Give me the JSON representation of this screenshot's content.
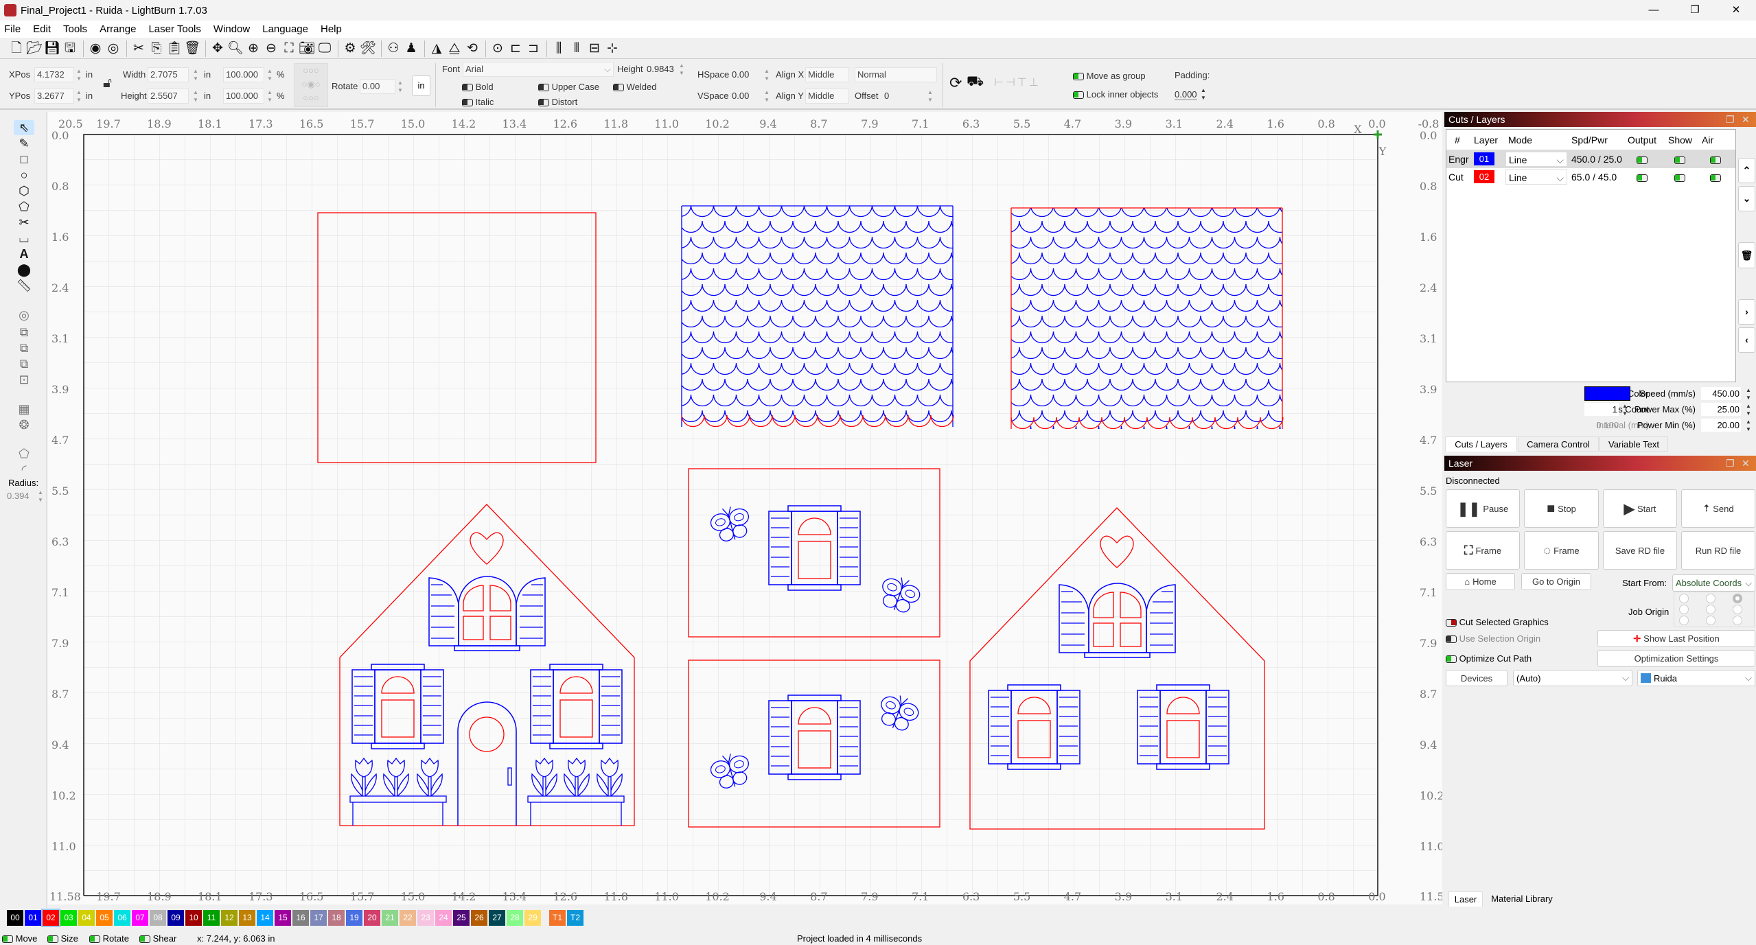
{
  "window": {
    "title": "Final_Project1 - Ruida - LightBurn 1.7.03",
    "minimize": "—",
    "maximize": "❐",
    "close": "✕"
  },
  "menu": [
    "File",
    "Edit",
    "Tools",
    "Arrange",
    "Laser Tools",
    "Window",
    "Language",
    "Help"
  ],
  "toolbar_icons": [
    "new-file",
    "open-file",
    "save",
    "save-as",
    "import",
    "export",
    "cut",
    "copy",
    "paste",
    "delete",
    "move",
    "zoom-to-page",
    "zoom-in",
    "zoom-out",
    "zoom-to-frame",
    "camera",
    "monitor",
    "settings",
    "machine-settings",
    "group",
    "ungroup",
    "mirror-horizontal",
    "mirror-vertical",
    "rotate",
    "align-center",
    "align-left",
    "align-right",
    "distribute-h",
    "distribute-v",
    "arrange-row",
    "snap"
  ],
  "props": {
    "xpos_label": "XPos",
    "xpos": "4.1732",
    "ypos_label": "YPos",
    "ypos": "3.2677",
    "unit": "in",
    "width_label": "Width",
    "width": "2.7075",
    "height_label": "Height",
    "height": "2.5507",
    "scale_x": "100.000",
    "scale_y": "100.000",
    "percent": "%",
    "rotate_label": "Rotate",
    "rotate": "0.00",
    "units_button": "in",
    "font_label": "Font",
    "font": "Arial",
    "font_height_label": "Height",
    "font_height": "0.9843",
    "bold": "Bold",
    "italic": "Italic",
    "upper_case": "Upper Case",
    "distort": "Distort",
    "welded": "Welded",
    "hspace_label": "HSpace",
    "hspace": "0.00",
    "vspace_label": "VSpace",
    "vspace": "0.00",
    "align_x_label": "Align X",
    "align_x": "Middle",
    "align_y_label": "Align Y",
    "align_y": "Middle",
    "text_mode": "Normal",
    "offset_label": "Offset",
    "offset": "0",
    "move_as_group": "Move as group",
    "lock_inner": "Lock inner objects",
    "padding_label": "Padding:",
    "padding": "0.000"
  },
  "left_tools": {
    "radius_label": "Radius:",
    "radius": "0.394"
  },
  "rulers": {
    "top": [
      "20.5",
      "19.7",
      "18.9",
      "18.1",
      "17.3",
      "16.5",
      "15.7",
      "15.0",
      "14.2",
      "13.4",
      "12.6",
      "11.8",
      "11.0",
      "10.2",
      "9.4",
      "8.7",
      "7.9",
      "7.1",
      "6.3",
      "5.5",
      "4.7",
      "3.9",
      "3.1",
      "2.4",
      "1.6",
      "0.8",
      "0.0"
    ],
    "top_extra": "-0.8",
    "side": [
      "0.0",
      "0.8",
      "1.6",
      "2.4",
      "3.1",
      "3.9",
      "4.7",
      "5.5",
      "6.3",
      "7.1",
      "7.9",
      "8.7",
      "9.4",
      "10.2",
      "11.0"
    ],
    "side_end": "11.58",
    "corner_x": "X",
    "corner_y": "Y"
  },
  "colors": {
    "engrave": "#0000ff",
    "cut": "#ff0000",
    "accent_on": "#1fbf1f"
  },
  "cuts_layers": {
    "title": "Cuts / Layers",
    "columns": [
      "#",
      "Layer",
      "Mode",
      "Spd/Pwr",
      "Output",
      "Show",
      "Air"
    ],
    "rows": [
      {
        "name": "Engr",
        "layer": "01",
        "color": "#0000ff",
        "mode": "Line",
        "spdpwr": "450.0 / 25.0",
        "output": true,
        "show": true,
        "air": true
      },
      {
        "name": "Cut",
        "layer": "02",
        "color": "#ff0000",
        "mode": "Line",
        "spdpwr": "65.0 / 45.0",
        "output": true,
        "show": true,
        "air": true
      }
    ],
    "layer_color_label": "Layer Color",
    "layer_color": "#0000ff",
    "speed_label": "Speed (mm/s)",
    "speed": "450.00",
    "pass_count_label": "Pass Count",
    "pass_count": "1",
    "power_max_label": "Power Max (%)",
    "power_max": "25.00",
    "interval_label": "Interval (mm)",
    "interval": "0.100",
    "power_min_label": "Power Min (%)",
    "power_min": "20.00",
    "tabs": [
      "Cuts / Layers",
      "Camera Control",
      "Variable Text"
    ]
  },
  "laser": {
    "title": "Laser",
    "status": "Disconnected",
    "pause": "Pause",
    "stop": "Stop",
    "start": "Start",
    "send": "Send",
    "frame_rect": "Frame",
    "frame_circle": "Frame",
    "save_rd": "Save RD file",
    "run_rd": "Run RD file",
    "home": "Home",
    "go_to_origin": "Go to Origin",
    "start_from_label": "Start From:",
    "start_from": "Absolute Coords",
    "job_origin_label": "Job Origin",
    "cut_selected": "Cut Selected Graphics",
    "use_selection_origin": "Use Selection Origin",
    "optimize_cut_path": "Optimize Cut Path",
    "show_last_position": "Show Last Position",
    "optimization_settings": "Optimization Settings",
    "devices": "Devices",
    "port": "(Auto)",
    "device": "Ruida"
  },
  "bottom_tabs": [
    "Laser",
    "Material Library"
  ],
  "palette": [
    {
      "label": "00",
      "color": "#000000"
    },
    {
      "label": "01",
      "color": "#0000ff"
    },
    {
      "label": "02",
      "color": "#ff0000"
    },
    {
      "label": "03",
      "color": "#00e000"
    },
    {
      "label": "04",
      "color": "#d0d000"
    },
    {
      "label": "05",
      "color": "#ff8000"
    },
    {
      "label": "06",
      "color": "#00e0e0"
    },
    {
      "label": "07",
      "color": "#ff00ff"
    },
    {
      "label": "08",
      "color": "#b4b4b4"
    },
    {
      "label": "09",
      "color": "#0000a0"
    },
    {
      "label": "10",
      "color": "#a00000"
    },
    {
      "label": "11",
      "color": "#00a000"
    },
    {
      "label": "12",
      "color": "#a0a000"
    },
    {
      "label": "13",
      "color": "#c08000"
    },
    {
      "label": "14",
      "color": "#00a0ff"
    },
    {
      "label": "15",
      "color": "#a000a0"
    },
    {
      "label": "16",
      "color": "#808080"
    },
    {
      "label": "17",
      "color": "#7d87b9"
    },
    {
      "label": "18",
      "color": "#bb7784"
    },
    {
      "label": "19",
      "color": "#4a6fe3"
    },
    {
      "label": "20",
      "color": "#d33f6a"
    },
    {
      "label": "21",
      "color": "#8cd78c"
    },
    {
      "label": "22",
      "color": "#f0b98d"
    },
    {
      "label": "23",
      "color": "#f6c4e1"
    },
    {
      "label": "24",
      "color": "#fa9ed4"
    },
    {
      "label": "25",
      "color": "#500a78"
    },
    {
      "label": "26",
      "color": "#b45a00"
    },
    {
      "label": "27",
      "color": "#004754"
    },
    {
      "label": "28",
      "color": "#86fa88"
    },
    {
      "label": "29",
      "color": "#ffdb66"
    },
    {
      "label": "T1",
      "color": "#f37328"
    },
    {
      "label": "T2",
      "color": "#0c97d9"
    }
  ],
  "status": {
    "move": "Move",
    "size": "Size",
    "rotate": "Rotate",
    "shear": "Shear",
    "coords": "x: 7.244, y: 6.063 in",
    "message": "Project loaded in 4 milliseconds"
  }
}
